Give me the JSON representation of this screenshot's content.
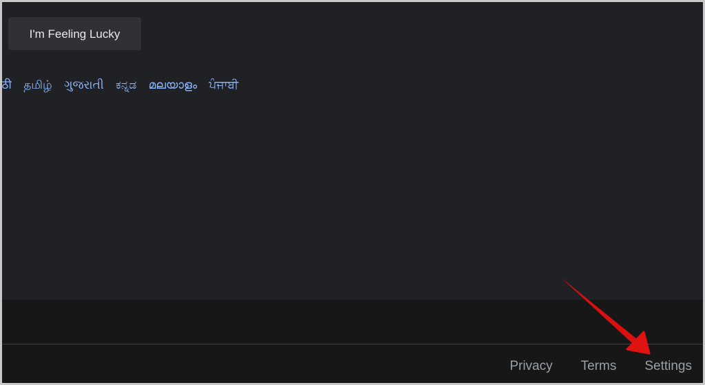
{
  "buttons": {
    "lucky": "I'm Feeling Lucky"
  },
  "languages": [
    "मराठी",
    "தமிழ்",
    "ગુજરાતી",
    "ಕನ್ನಡ",
    "മലയാളം",
    "ਪੰਜਾਬੀ"
  ],
  "footer": {
    "links": [
      "Privacy",
      "Terms",
      "Settings"
    ]
  },
  "annotation": {
    "arrow_color": "#e01010",
    "target": "Settings"
  }
}
